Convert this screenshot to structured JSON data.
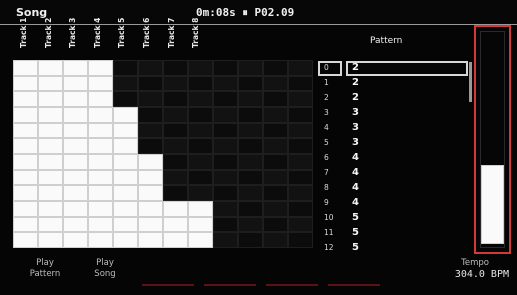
{
  "header": {
    "title": "Song",
    "time": "0m:08s",
    "pause_symbol": "⏸",
    "position": "P02.09"
  },
  "tracks": [
    "Track 1",
    "Track 2",
    "Track 3",
    "Track 4",
    "Track 5",
    "Track 6",
    "Track 7",
    "Track 8"
  ],
  "grid": {
    "columns": 12,
    "rows": [
      [
        1,
        1,
        1,
        1,
        0,
        0,
        0,
        0,
        0,
        0,
        0,
        0
      ],
      [
        1,
        1,
        1,
        1,
        0,
        0,
        0,
        0,
        0,
        0,
        0,
        0
      ],
      [
        1,
        1,
        1,
        1,
        0,
        0,
        0,
        0,
        0,
        0,
        0,
        0
      ],
      [
        1,
        1,
        1,
        1,
        1,
        0,
        0,
        0,
        0,
        0,
        0,
        0
      ],
      [
        1,
        1,
        1,
        1,
        1,
        0,
        0,
        0,
        0,
        0,
        0,
        0
      ],
      [
        1,
        1,
        1,
        1,
        1,
        0,
        0,
        0,
        0,
        0,
        0,
        0
      ],
      [
        1,
        1,
        1,
        1,
        1,
        1,
        0,
        0,
        0,
        0,
        0,
        0
      ],
      [
        1,
        1,
        1,
        1,
        1,
        1,
        0,
        0,
        0,
        0,
        0,
        0
      ],
      [
        1,
        1,
        1,
        1,
        1,
        1,
        0,
        0,
        0,
        0,
        0,
        0
      ],
      [
        1,
        1,
        1,
        1,
        1,
        1,
        1,
        1,
        0,
        0,
        0,
        0
      ],
      [
        1,
        1,
        1,
        1,
        1,
        1,
        1,
        1,
        0,
        0,
        0,
        0
      ],
      [
        1,
        1,
        1,
        1,
        1,
        1,
        1,
        1,
        0,
        0,
        0,
        0
      ]
    ]
  },
  "pattern_panel": {
    "header": "Pattern",
    "selected_index": 0,
    "rows": [
      {
        "index": "0",
        "value": "2"
      },
      {
        "index": "1",
        "value": "2"
      },
      {
        "index": "2",
        "value": "2"
      },
      {
        "index": "3",
        "value": "3"
      },
      {
        "index": "4",
        "value": "3"
      },
      {
        "index": "5",
        "value": "3"
      },
      {
        "index": "6",
        "value": "4"
      },
      {
        "index": "7",
        "value": "4"
      },
      {
        "index": "8",
        "value": "4"
      },
      {
        "index": "9",
        "value": "4"
      },
      {
        "index": "10",
        "value": "5"
      },
      {
        "index": "11",
        "value": "5"
      },
      {
        "index": "12",
        "value": "5"
      }
    ]
  },
  "level_meter": {
    "fraction": 0.36
  },
  "footer": {
    "play_pattern": [
      "Play",
      "Pattern"
    ],
    "play_song": [
      "Play",
      "Song"
    ],
    "tempo_label": "Tempo",
    "tempo_value": "304.0 BPM"
  },
  "colors": {
    "accent": "#d23a3a",
    "step_on": "#fafafa",
    "background": "#050505"
  }
}
